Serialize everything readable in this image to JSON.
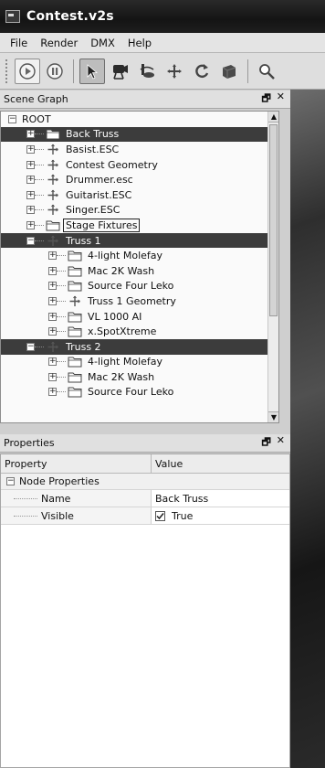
{
  "window": {
    "title": "Contest.v2s"
  },
  "menu": [
    "File",
    "Render",
    "DMX",
    "Help"
  ],
  "toolbar": {
    "buttons": [
      "play-icon",
      "pause-icon",
      "select-arrow-icon",
      "spotlight-icon",
      "rotate-object-icon",
      "move-icon",
      "refresh-icon",
      "box-icon",
      "zoom-icon"
    ]
  },
  "scene_graph": {
    "title": "Scene Graph",
    "float_glyph": "🗗",
    "close_glyph": "✕",
    "root": "ROOT",
    "items": [
      {
        "label": "Back Truss",
        "icon": "folder",
        "level": 1,
        "expander": "+",
        "selected": true
      },
      {
        "label": "Basist.ESC",
        "icon": "node",
        "level": 1,
        "expander": "+"
      },
      {
        "label": "Contest Geometry",
        "icon": "node",
        "level": 1,
        "expander": "+"
      },
      {
        "label": "Drummer.esc",
        "icon": "node",
        "level": 1,
        "expander": "+"
      },
      {
        "label": "Guitarist.ESC",
        "icon": "node",
        "level": 1,
        "expander": "+"
      },
      {
        "label": "Singer.ESC",
        "icon": "node",
        "level": 1,
        "expander": "+"
      },
      {
        "label": "Stage Fixtures",
        "icon": "folder",
        "level": 1,
        "expander": "+",
        "outlined": true
      },
      {
        "label": "Truss 1",
        "icon": "node",
        "level": 1,
        "expander": "−",
        "selected": true
      },
      {
        "label": "4-light Molefay",
        "icon": "folder",
        "level": 2,
        "expander": "+"
      },
      {
        "label": "Mac 2K Wash",
        "icon": "folder",
        "level": 2,
        "expander": "+"
      },
      {
        "label": "Source Four Leko",
        "icon": "folder",
        "level": 2,
        "expander": "+"
      },
      {
        "label": "Truss 1 Geometry",
        "icon": "node",
        "level": 2,
        "expander": "+"
      },
      {
        "label": "VL 1000 AI",
        "icon": "folder",
        "level": 2,
        "expander": "+"
      },
      {
        "label": "x.SpotXtreme",
        "icon": "folder",
        "level": 2,
        "expander": "+"
      },
      {
        "label": "Truss 2",
        "icon": "node",
        "level": 1,
        "expander": "−",
        "selected": true
      },
      {
        "label": "4-light Molefay",
        "icon": "folder",
        "level": 2,
        "expander": "+"
      },
      {
        "label": "Mac 2K Wash",
        "icon": "folder",
        "level": 2,
        "expander": "+"
      },
      {
        "label": "Source Four Leko",
        "icon": "folder",
        "level": 2,
        "expander": "+"
      }
    ]
  },
  "properties": {
    "title": "Properties",
    "float_glyph": "🗗",
    "close_glyph": "✕",
    "columns": [
      "Property",
      "Value"
    ],
    "group": "Node Properties",
    "rows": [
      {
        "key": "Name",
        "value": "Back Truss"
      },
      {
        "key": "Visible",
        "value": "True",
        "checked": true
      }
    ]
  },
  "colors": {
    "selection": "#3c3c3c",
    "titlebar": "#1a1a1a"
  }
}
